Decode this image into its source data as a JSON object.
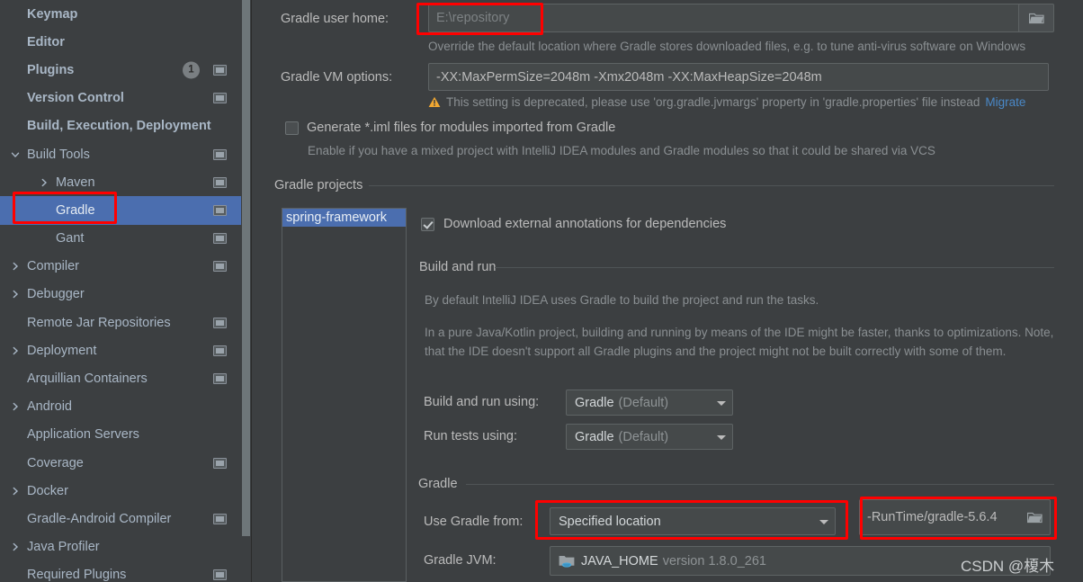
{
  "colors": {
    "background": "#3c3f41",
    "selection_blue": "#4b6eaf",
    "text": "#bbbbbb",
    "muted_text": "#8a8f92",
    "link_blue": "#4a88c7",
    "highlight_red": "#ff0000",
    "warning_amber": "#f0a732"
  },
  "sidebar": {
    "items": [
      {
        "label": "Keymap",
        "indent": 0,
        "bold": true,
        "arrow": "none",
        "chip": false,
        "badge": null,
        "selected": false
      },
      {
        "label": "Editor",
        "indent": 0,
        "bold": true,
        "arrow": "none",
        "chip": false,
        "badge": null,
        "selected": false
      },
      {
        "label": "Plugins",
        "indent": 0,
        "bold": true,
        "arrow": "none",
        "chip": true,
        "badge": "1",
        "selected": false
      },
      {
        "label": "Version Control",
        "indent": 0,
        "bold": true,
        "arrow": "none",
        "chip": true,
        "badge": null,
        "selected": false
      },
      {
        "label": "Build, Execution, Deployment",
        "indent": 0,
        "bold": true,
        "arrow": "none",
        "chip": false,
        "badge": null,
        "selected": false
      },
      {
        "label": "Build Tools",
        "indent": 1,
        "bold": false,
        "arrow": "down",
        "chip": true,
        "badge": null,
        "selected": false
      },
      {
        "label": "Maven",
        "indent": 2,
        "bold": false,
        "arrow": "right",
        "chip": true,
        "badge": null,
        "selected": false
      },
      {
        "label": "Gradle",
        "indent": 3,
        "bold": false,
        "arrow": "none",
        "chip": true,
        "badge": null,
        "selected": true
      },
      {
        "label": "Gant",
        "indent": 3,
        "bold": false,
        "arrow": "none",
        "chip": true,
        "badge": null,
        "selected": false
      },
      {
        "label": "Compiler",
        "indent": 1,
        "bold": false,
        "arrow": "right",
        "chip": true,
        "badge": null,
        "selected": false
      },
      {
        "label": "Debugger",
        "indent": 1,
        "bold": false,
        "arrow": "right",
        "chip": false,
        "badge": null,
        "selected": false
      },
      {
        "label": "Remote Jar Repositories",
        "indent": 1,
        "bold": false,
        "arrow": "none",
        "chip": true,
        "badge": null,
        "selected": false
      },
      {
        "label": "Deployment",
        "indent": 1,
        "bold": false,
        "arrow": "right",
        "chip": true,
        "badge": null,
        "selected": false
      },
      {
        "label": "Arquillian Containers",
        "indent": 1,
        "bold": false,
        "arrow": "none",
        "chip": true,
        "badge": null,
        "selected": false
      },
      {
        "label": "Android",
        "indent": 1,
        "bold": false,
        "arrow": "right",
        "chip": false,
        "badge": null,
        "selected": false
      },
      {
        "label": "Application Servers",
        "indent": 1,
        "bold": false,
        "arrow": "none",
        "chip": false,
        "badge": null,
        "selected": false
      },
      {
        "label": "Coverage",
        "indent": 1,
        "bold": false,
        "arrow": "none",
        "chip": true,
        "badge": null,
        "selected": false
      },
      {
        "label": "Docker",
        "indent": 1,
        "bold": false,
        "arrow": "right",
        "chip": false,
        "badge": null,
        "selected": false
      },
      {
        "label": "Gradle-Android Compiler",
        "indent": 1,
        "bold": false,
        "arrow": "none",
        "chip": true,
        "badge": null,
        "selected": false
      },
      {
        "label": "Java Profiler",
        "indent": 1,
        "bold": false,
        "arrow": "right",
        "chip": false,
        "badge": null,
        "selected": false
      },
      {
        "label": "Required Plugins",
        "indent": 1,
        "bold": false,
        "arrow": "none",
        "chip": true,
        "badge": null,
        "selected": false
      }
    ]
  },
  "main": {
    "gradle_user_home": {
      "label": "Gradle user home:",
      "value": "E:\\repository",
      "placeholder": "E:\\repository",
      "hint": "Override the default location where Gradle stores downloaded files, e.g. to tune anti-virus software on Windows"
    },
    "gradle_vm_options": {
      "label": "Gradle VM options:",
      "value": "-XX:MaxPermSize=2048m -Xmx2048m -XX:MaxHeapSize=2048m",
      "warning": "This setting is deprecated, please use 'org.gradle.jvmargs' property in 'gradle.properties' file instead",
      "warning_link": "Migrate"
    },
    "generate_iml": {
      "label": "Generate *.iml files for modules imported from Gradle",
      "checked": false,
      "hint": "Enable if you have a mixed project with IntelliJ IDEA modules and Gradle modules so that it could be shared via VCS"
    },
    "gradle_projects": {
      "group_title": "Gradle projects",
      "projects": [
        "spring-framework"
      ],
      "download_annotations": {
        "label": "Download external annotations for dependencies",
        "checked": true
      }
    },
    "build_and_run": {
      "group_title": "Build and run",
      "paragraph1": "By default IntelliJ IDEA uses Gradle to build the project and run the tasks.",
      "paragraph2": "In a pure Java/Kotlin project, building and running by means of the IDE might be faster, thanks to optimizations. Note, that the IDE doesn't support all Gradle plugins and the project might not be built correctly with some of them.",
      "build_run_using": {
        "label": "Build and run using:",
        "value": "Gradle",
        "value_suffix": "(Default)"
      },
      "run_tests_using": {
        "label": "Run tests using:",
        "value": "Gradle",
        "value_suffix": "(Default)"
      }
    },
    "gradle_section": {
      "group_title": "Gradle",
      "use_gradle_from": {
        "label": "Use Gradle from:",
        "value": "Specified location",
        "path_value": "-RunTime/gradle-5.6.4"
      },
      "gradle_jvm": {
        "label": "Gradle JVM:",
        "value": "JAVA_HOME",
        "value_suffix": "version 1.8.0_261"
      }
    }
  },
  "watermark": {
    "text": "CSDN @榎木"
  }
}
